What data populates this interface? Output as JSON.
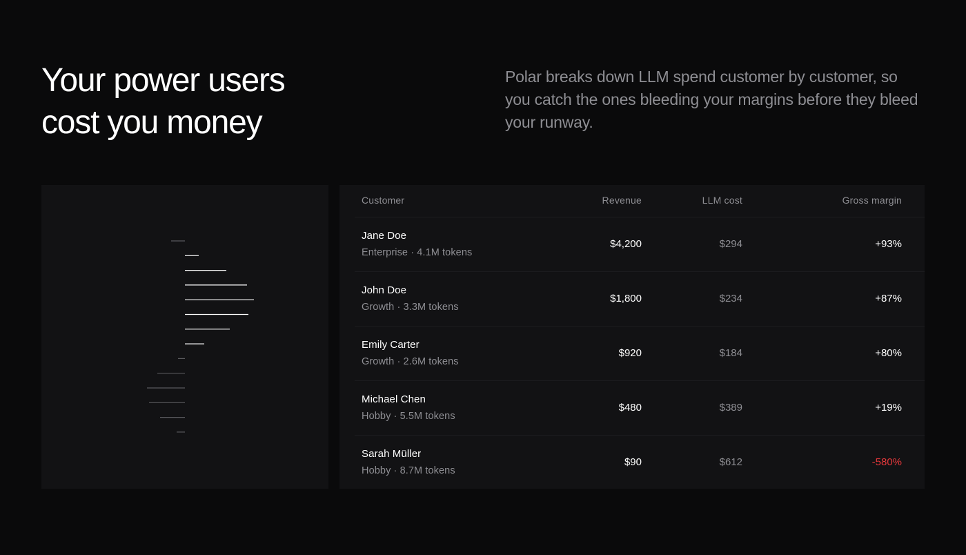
{
  "hero": {
    "headline_line1": "Your power users",
    "headline_line2": "cost you money",
    "description": "Polar breaks down LLM spend customer by customer, so you catch the ones bleeding your margins before they bleed your runway."
  },
  "table": {
    "headers": {
      "customer": "Customer",
      "revenue": "Revenue",
      "cost": "LLM cost",
      "margin": "Gross margin"
    },
    "rows": [
      {
        "name": "Jane Doe",
        "plan": "Enterprise · 4.1M tokens",
        "revenue": "$4,200",
        "cost": "$294",
        "margin": "+93%",
        "negative": false
      },
      {
        "name": "John Doe",
        "plan": "Growth · 3.3M tokens",
        "revenue": "$1,800",
        "cost": "$234",
        "margin": "+87%",
        "negative": false
      },
      {
        "name": "Emily Carter",
        "plan": "Growth · 2.6M tokens",
        "revenue": "$920",
        "cost": "$184",
        "margin": "+80%",
        "negative": false
      },
      {
        "name": "Michael Chen",
        "plan": "Hobby · 5.5M tokens",
        "revenue": "$480",
        "cost": "$389",
        "margin": "+19%",
        "negative": false
      },
      {
        "name": "Sarah Müller",
        "plan": "Hobby · 8.7M tokens",
        "revenue": "$90",
        "cost": "$612",
        "margin": "-580%",
        "negative": true
      }
    ]
  },
  "colors": {
    "background": "#0a0a0b",
    "card": "#121214",
    "muted_text": "#8e8e93",
    "negative": "#e5383b",
    "positive_bar": "#ffffff",
    "negative_bar": "#5a5a5e"
  },
  "chart_data": {
    "type": "bar",
    "orientation": "horizontal",
    "baseline": 0,
    "values": [
      -1,
      1,
      3,
      4.5,
      5,
      4.6,
      3.25,
      1.4,
      -0.5,
      -2,
      -2.75,
      -2.6,
      -1.8,
      -0.6
    ]
  }
}
